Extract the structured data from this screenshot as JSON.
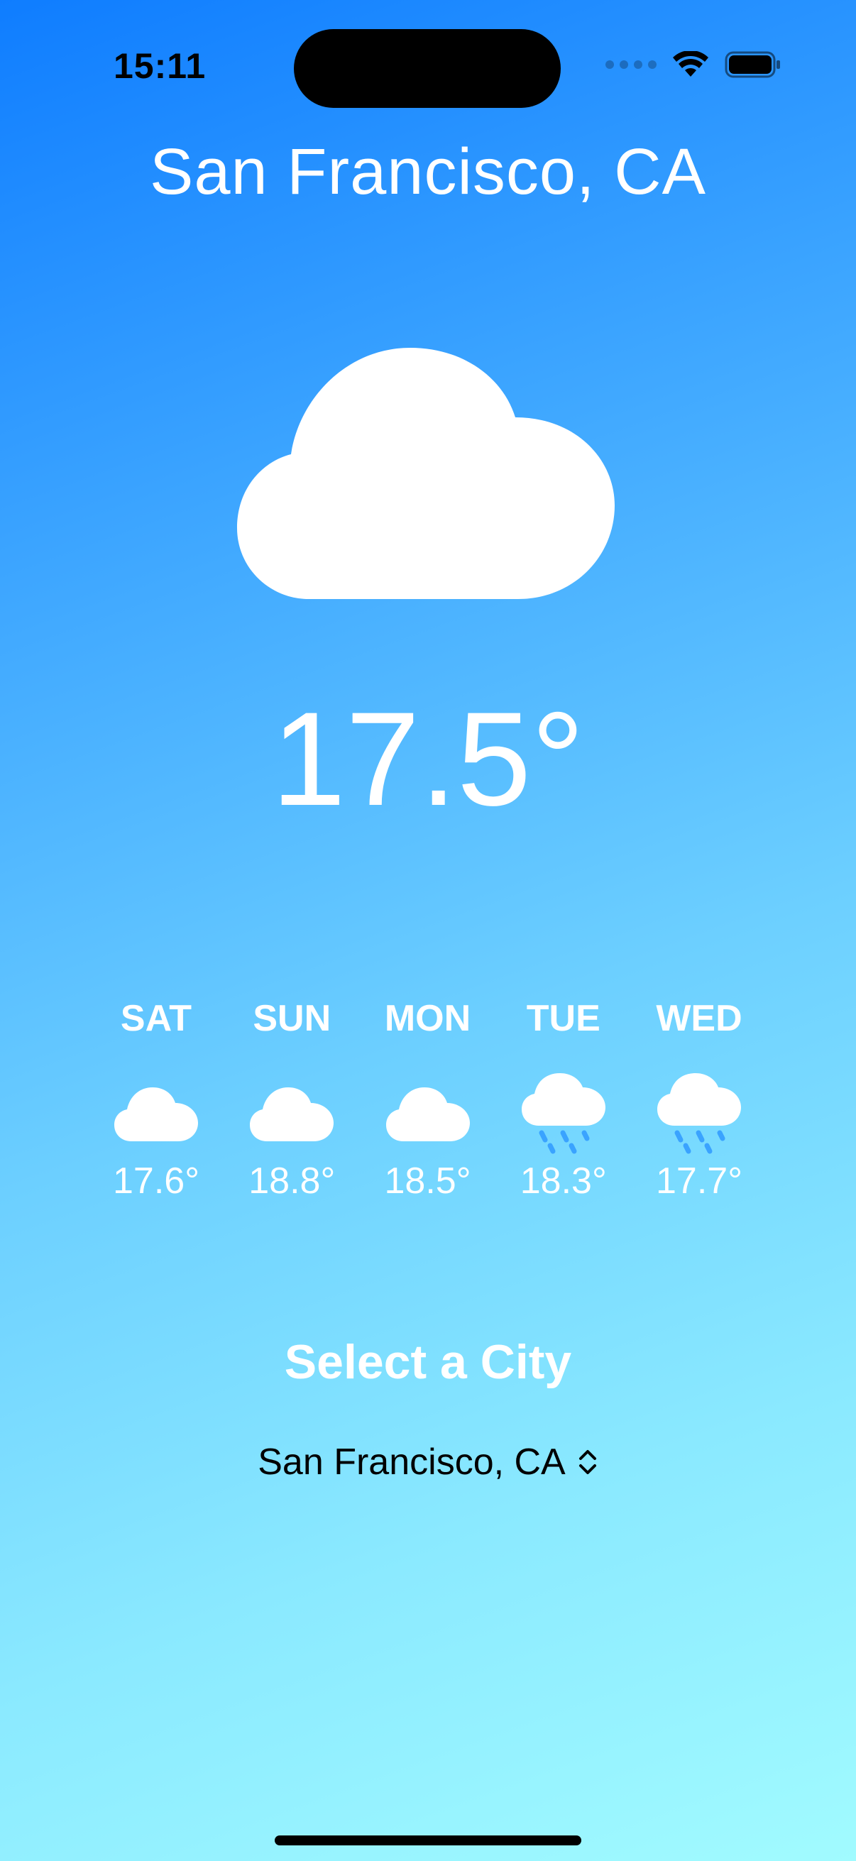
{
  "status_bar": {
    "time": "15:11"
  },
  "city_title": "San Francisco, CA",
  "current": {
    "icon": "cloud-icon",
    "temperature": "17.5°"
  },
  "forecast": [
    {
      "day": "SAT",
      "icon": "cloud-icon",
      "temp": "17.6°"
    },
    {
      "day": "SUN",
      "icon": "cloud-icon",
      "temp": "18.8°"
    },
    {
      "day": "MON",
      "icon": "cloud-icon",
      "temp": "18.5°"
    },
    {
      "day": "TUE",
      "icon": "cloud-rain-icon",
      "temp": "18.3°"
    },
    {
      "day": "WED",
      "icon": "cloud-rain-icon",
      "temp": "17.7°"
    }
  ],
  "selector": {
    "label": "Select a City",
    "selected_city": "San Francisco, CA"
  },
  "colors": {
    "gradient_top": "#0f7dff",
    "gradient_bottom": "#a1fbff",
    "rain": "#3aa3ff"
  }
}
